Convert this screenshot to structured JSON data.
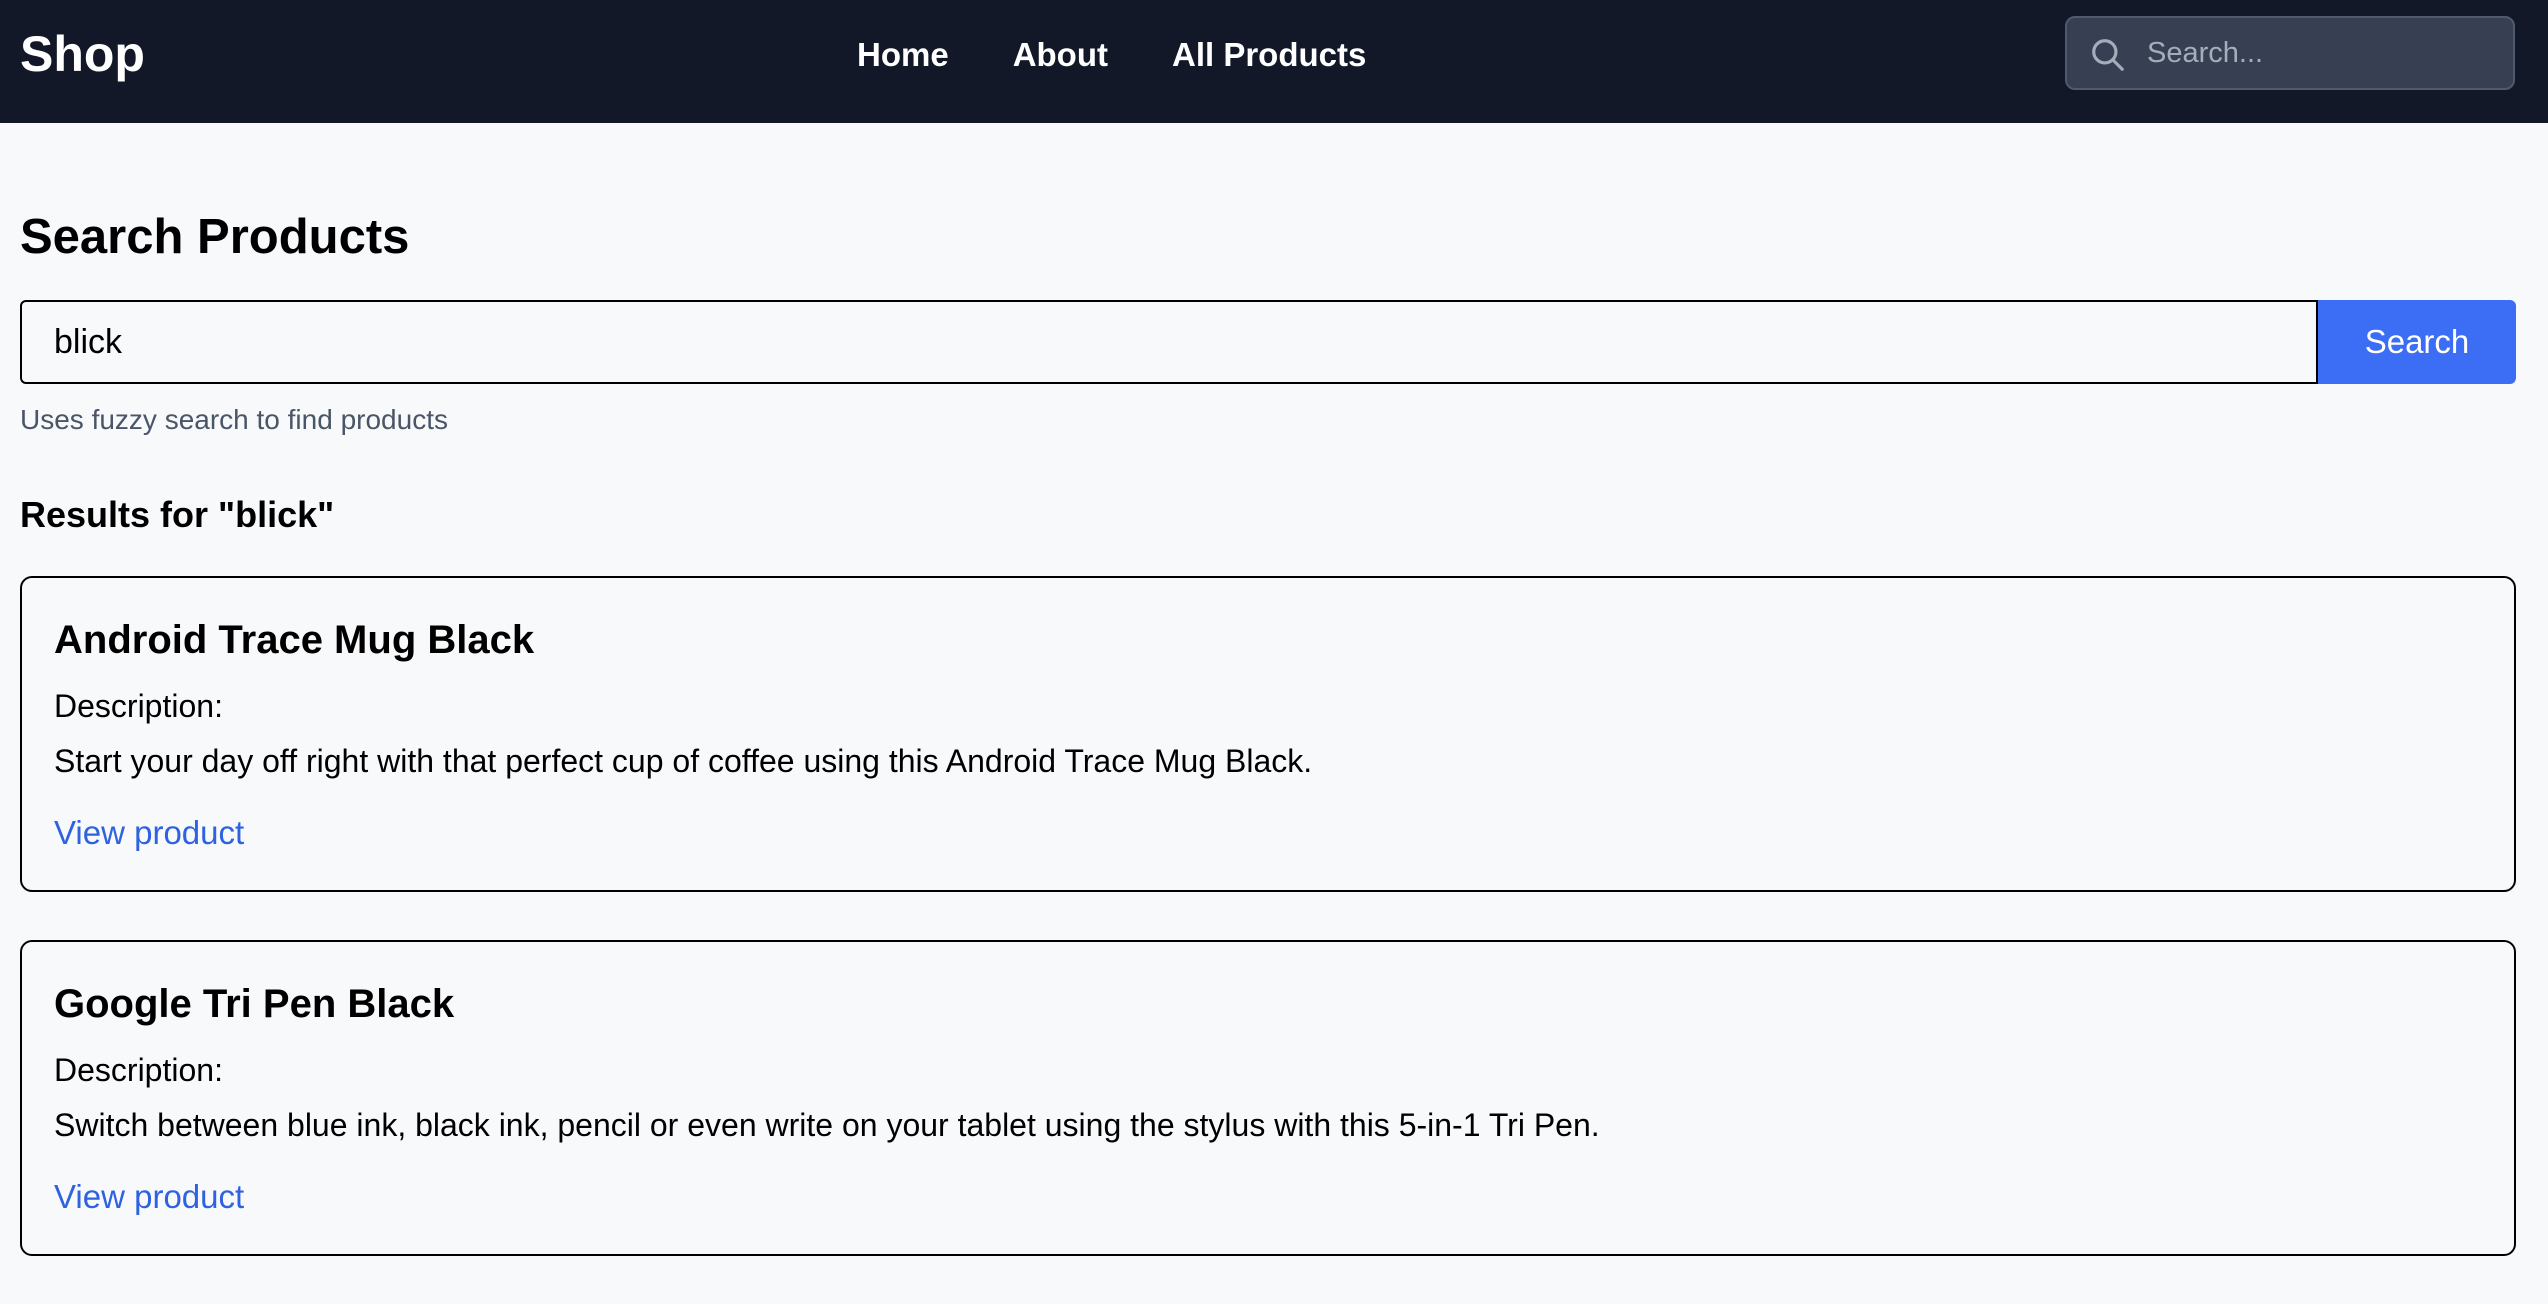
{
  "navbar": {
    "brand": "Shop",
    "links": [
      {
        "label": "Home"
      },
      {
        "label": "About"
      },
      {
        "label": "All Products"
      }
    ],
    "search": {
      "placeholder": "Search...",
      "icon": "search-icon"
    }
  },
  "main": {
    "title": "Search Products",
    "search_value": "blick",
    "search_button_label": "Search",
    "hint": "Uses fuzzy search to find products",
    "results_heading": "Results for \"blick\"",
    "results": [
      {
        "title": "Android Trace Mug Black",
        "description_label": "Description:",
        "description": "Start your day off right with that perfect cup of coffee using this Android Trace Mug Black.",
        "link_label": "View product"
      },
      {
        "title": "Google Tri Pen Black",
        "description_label": "Description:",
        "description": "Switch between blue ink, black ink, pencil or even write on your tablet using the stylus with this 5-in-1 Tri Pen.",
        "link_label": "View product"
      }
    ]
  },
  "colors": {
    "navbar_bg": "#121828",
    "page_bg": "#f8f9fb",
    "accent": "#3b6ef4",
    "link": "#2f62e0",
    "hint_text": "#4a5567"
  }
}
